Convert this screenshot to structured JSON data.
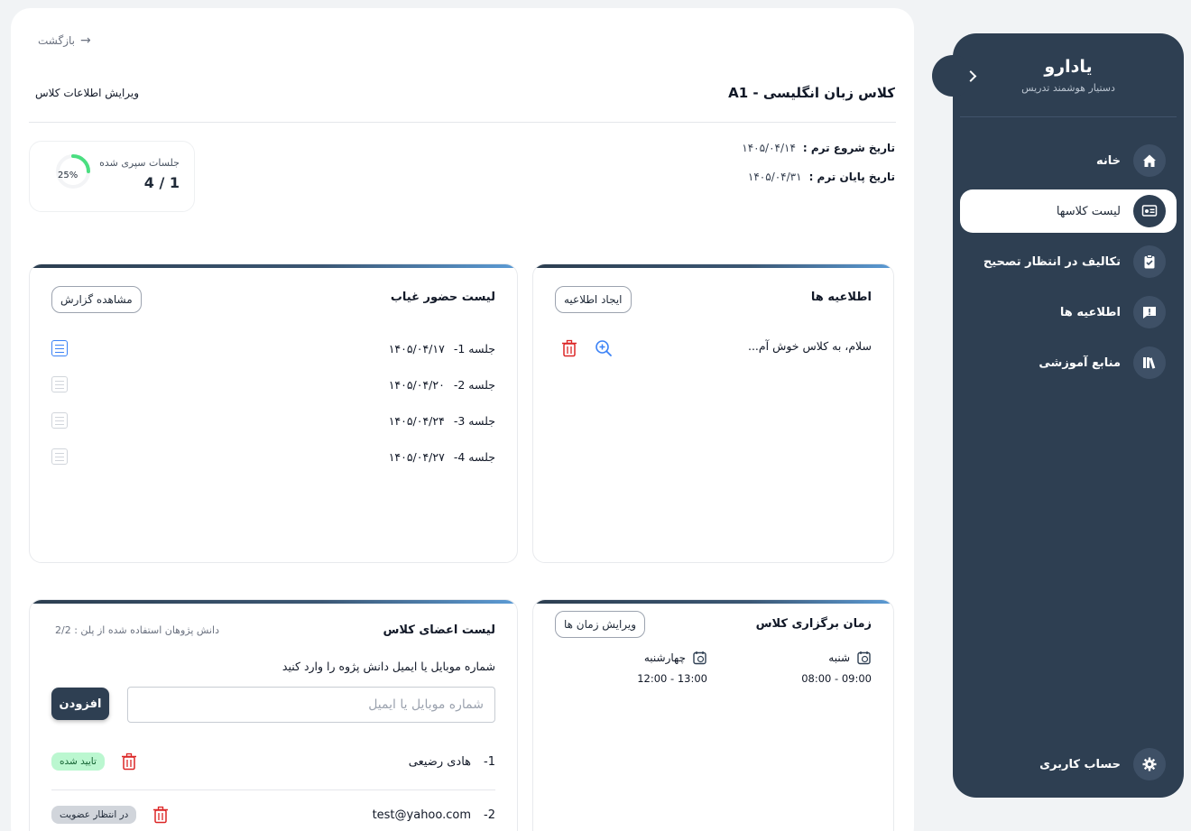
{
  "sidebar": {
    "brand_name": "یادارو",
    "brand_subtitle": "دستیار هوشمند تدریس",
    "items": [
      {
        "label": "خانه",
        "icon": "home-icon"
      },
      {
        "label": "لیست کلاسها",
        "icon": "class-list-icon"
      },
      {
        "label": "تکالیف در انتظار تصحیح",
        "icon": "clipboard-check-icon"
      },
      {
        "label": "اطلاعیه ها",
        "icon": "announcement-icon"
      },
      {
        "label": "منابع آموزشی",
        "icon": "books-icon"
      }
    ],
    "account_label": "حساب کاربری",
    "active_index": 1
  },
  "header": {
    "back_label": "بازگشت",
    "class_title": "کلاس زبان انگلیسی - A1",
    "edit_link": "ویرایش اطلاعات کلاس"
  },
  "term": {
    "start_label": "تاریخ شروع ترم :",
    "start_value": "۱۴۰۵/۰۴/۱۴",
    "end_label": "تاریخ پایان ترم :",
    "end_value": "۱۴۰۵/۰۴/۳۱"
  },
  "progress": {
    "label": "جلسات سپری شده",
    "value": "4 / 1",
    "percent_label": "25%",
    "fraction": 0.25
  },
  "attendance": {
    "title": "لیست حضور غیاب",
    "report_button": "مشاهده گزارش",
    "sessions": [
      {
        "name": "جلسه 1-",
        "date": "۱۴۰۵/۰۴/۱۷"
      },
      {
        "name": "جلسه 2-",
        "date": "۱۴۰۵/۰۴/۲۰"
      },
      {
        "name": "جلسه 3-",
        "date": "۱۴۰۵/۰۴/۲۴"
      },
      {
        "name": "جلسه 4-",
        "date": "۱۴۰۵/۰۴/۲۷"
      }
    ]
  },
  "announcements": {
    "title": "اطلاعیه ها",
    "create_button": "ایجاد اطلاعیه",
    "items": [
      {
        "text": "سلام، به کلاس خوش آم..."
      }
    ]
  },
  "members": {
    "title": "لیست اعضای کلاس",
    "plan_usage": "دانش پژوهان استفاده شده از پلن : 2/2",
    "instruction": "شماره موبایل یا ایمیل دانش پژوه را وارد کنید",
    "input_placeholder": "شماره موبایل یا ایمیل",
    "add_button": "افزودن",
    "rows": [
      {
        "index": "1-",
        "name": "هادی رضیعی",
        "status": "تایید شده",
        "status_kind": "ok"
      },
      {
        "index": "2-",
        "name": "test@yahoo.com",
        "status": "در انتظار عضویت",
        "status_kind": "wait"
      }
    ]
  },
  "schedule": {
    "title": "زمان برگزاری کلاس",
    "edit_button": "ویرایش زمان ها",
    "slots": [
      {
        "day": "شنبه",
        "time": "09:00 - 08:00"
      },
      {
        "day": "چهارشنبه",
        "time": "13:00 - 12:00"
      }
    ]
  },
  "colors": {
    "sidebar_bg": "#2e3f52",
    "accent_green": "#4ade80",
    "delete_red": "#dc2626",
    "link_blue": "#3b82f6"
  }
}
